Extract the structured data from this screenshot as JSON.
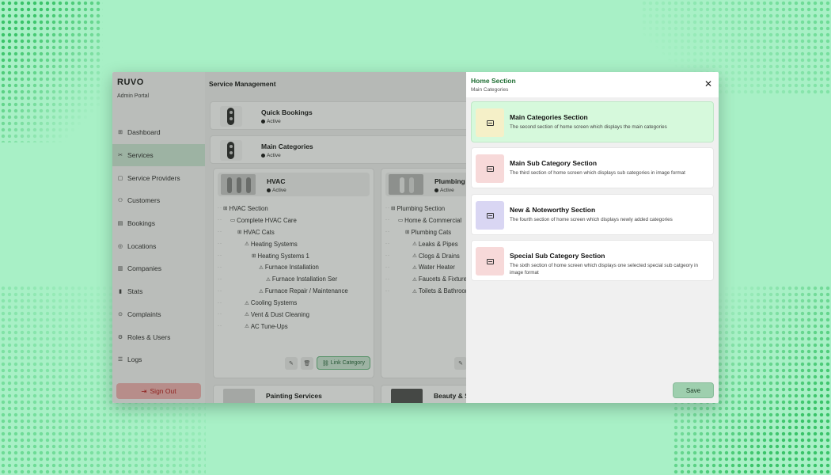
{
  "sidebar": {
    "brand": "RUVO",
    "brand_sub": "Admin Portal",
    "items": [
      {
        "label": "Dashboard",
        "icon": "⊞"
      },
      {
        "label": "Services",
        "icon": "✂"
      },
      {
        "label": "Service Providers",
        "icon": "▢"
      },
      {
        "label": "Customers",
        "icon": "⚇"
      },
      {
        "label": "Bookings",
        "icon": "▤"
      },
      {
        "label": "Locations",
        "icon": "◎"
      },
      {
        "label": "Companies",
        "icon": "▥"
      },
      {
        "label": "Stats",
        "icon": "▮"
      },
      {
        "label": "Complaints",
        "icon": "⊙"
      },
      {
        "label": "Roles & Users",
        "icon": "⚙"
      },
      {
        "label": "Logs",
        "icon": "☰"
      }
    ],
    "active_index": 1,
    "signout_label": "Sign Out",
    "signout_icon": "⇥"
  },
  "main": {
    "title": "Service Management",
    "rows": [
      {
        "title": "Quick Bookings",
        "status": "Active"
      },
      {
        "title": "Main Categories",
        "status": "Active"
      }
    ],
    "categories": [
      {
        "title": "HVAC",
        "status": "Active",
        "tree": [
          {
            "depth": 0,
            "icon": "⊞",
            "label": "HVAC Section"
          },
          {
            "depth": 1,
            "icon": "▭",
            "label": "Complete HVAC Care"
          },
          {
            "depth": 2,
            "icon": "⊞",
            "label": "HVAC Cats"
          },
          {
            "depth": 3,
            "icon": "⚠",
            "label": "Heating Systems"
          },
          {
            "depth": 4,
            "icon": "⊞",
            "label": "Heating Systems 1"
          },
          {
            "depth": 5,
            "icon": "⚠",
            "label": "Furnace Installation"
          },
          {
            "depth": 6,
            "icon": "⚠",
            "label": "Furnace Installation Ser"
          },
          {
            "depth": 5,
            "icon": "⚠",
            "label": "Furnace Repair / Maintenance"
          },
          {
            "depth": 3,
            "icon": "⚠",
            "label": "Cooling Systems"
          },
          {
            "depth": 3,
            "icon": "⚠",
            "label": "Vent & Dust Cleaning"
          },
          {
            "depth": 3,
            "icon": "⚠",
            "label": "AC Tune-Ups"
          }
        ],
        "link_label": "Link Category"
      },
      {
        "title": "Plumbing",
        "status": "Active",
        "tree": [
          {
            "depth": 0,
            "icon": "⊞",
            "label": "Plumbing Section"
          },
          {
            "depth": 1,
            "icon": "▭",
            "label": "Home & Commercial"
          },
          {
            "depth": 2,
            "icon": "⊞",
            "label": "Plumbing Cats"
          },
          {
            "depth": 3,
            "icon": "⚠",
            "label": "Leaks & Pipes"
          },
          {
            "depth": 3,
            "icon": "⚠",
            "label": "Clogs & Drains"
          },
          {
            "depth": 3,
            "icon": "⚠",
            "label": "Water Heater"
          },
          {
            "depth": 3,
            "icon": "⚠",
            "label": "Faucets & Fixtures"
          },
          {
            "depth": 3,
            "icon": "⚠",
            "label": "Toilets & Bathrooms"
          }
        ]
      }
    ],
    "bottom_cards": [
      {
        "title": "Painting Services"
      },
      {
        "title": "Beauty & Spa"
      }
    ]
  },
  "panel": {
    "title": "Home Section",
    "subtitle": "Main Categories",
    "close_icon": "✕",
    "sections": [
      {
        "title": "Main Categories Section",
        "desc": "The second section of home screen which displays the main categories",
        "icon_bg": "#f5f0c8",
        "selected": true
      },
      {
        "title": "Main Sub Category Section",
        "desc": "The third section of home screen which displays sub categories in image format",
        "icon_bg": "#f7d9d9",
        "selected": false
      },
      {
        "title": "New & Noteworthy Section",
        "desc": "The fourth section of home screen which displays newly added categories",
        "icon_bg": "#d9d6f3",
        "selected": false
      },
      {
        "title": "Special Sub Category Section",
        "desc": "The sixth section of home screen which displays one selected special sub catgeory in image format",
        "icon_bg": "#f7d9d9",
        "selected": false
      }
    ],
    "save_label": "Save"
  }
}
